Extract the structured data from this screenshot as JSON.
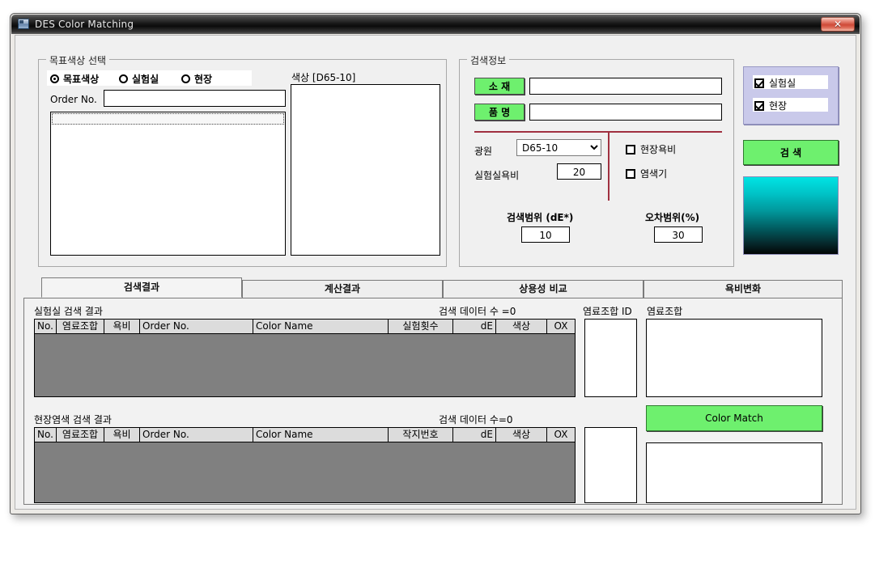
{
  "window": {
    "title": "DES Color Matching",
    "close_label": "✕",
    "icon": "app-icon"
  },
  "target_group": {
    "legend": "목표색상 선택",
    "radios": [
      {
        "label": "목표색상",
        "selected": true
      },
      {
        "label": "실험실",
        "selected": false
      },
      {
        "label": "현장",
        "selected": false
      }
    ],
    "order_no_label": "Order No.",
    "order_no_value": "",
    "list_placeholder": ""
  },
  "color_panel": {
    "label": "색상 [D65-10]"
  },
  "search_info": {
    "legend": "검색정보",
    "material_button": "소 재",
    "material_value": "",
    "product_button": "품 명",
    "product_value": "",
    "light_source_label": "광원",
    "light_source_value": "D65-10",
    "light_source_options": [
      "D65-10"
    ],
    "lab_ratio_label": "실험실욕비",
    "lab_ratio_value": "20",
    "checkboxes": [
      {
        "label": "현장욕비",
        "checked": false
      },
      {
        "label": "염색기",
        "checked": false
      }
    ],
    "range_de_label": "검색범위 (dE*)",
    "range_de_value": "10",
    "tolerance_label": "오차범위(%)",
    "tolerance_value": "30"
  },
  "side_panel": {
    "checkboxes": [
      {
        "label": "실험실",
        "checked": true
      },
      {
        "label": "현장",
        "checked": true
      }
    ],
    "search_button": "검 색",
    "swatch_top_color": "#00e4e4",
    "swatch_bottom_color": "#000000"
  },
  "tabs": [
    {
      "label": "검색결과",
      "active": true
    },
    {
      "label": "계산결과",
      "active": false
    },
    {
      "label": "상용성 비교",
      "active": false
    },
    {
      "label": "욕비변화",
      "active": false
    }
  ],
  "lab_results": {
    "caption": "실험실 검색 결과",
    "count_text": "검색 데이터 수 =0",
    "columns": [
      "No.",
      "염료조합",
      "욕비",
      "Order No.",
      "Color Name",
      "실험횟수",
      "dE",
      "색상",
      "OX"
    ],
    "rows": []
  },
  "field_results": {
    "caption": "현장염색 검색 결과",
    "count_text": "검색 데이터 수=0",
    "columns": [
      "No.",
      "염료조합",
      "욕비",
      "Order No.",
      "Color Name",
      "작지번호",
      "dE",
      "색상",
      "OX"
    ],
    "rows": []
  },
  "dye_panel": {
    "id_label": "염료조합 ID",
    "combo_label": "염료조합",
    "id_value_top": "",
    "combo_value_top": "",
    "id_value_bottom": "",
    "combo_value_bottom": "",
    "color_match_button": "Color Match"
  }
}
